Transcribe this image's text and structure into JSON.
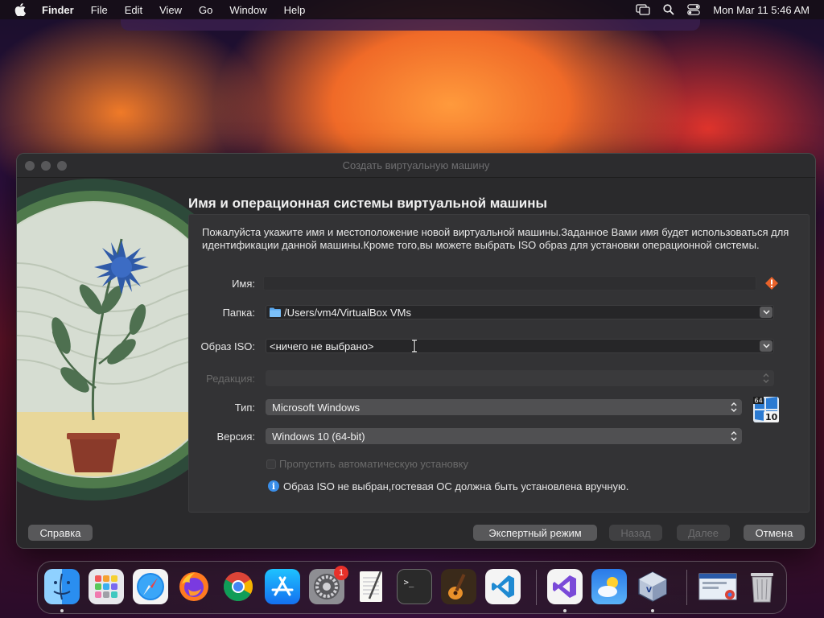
{
  "menubar": {
    "app_name": "Finder",
    "items": [
      "File",
      "Edit",
      "View",
      "Go",
      "Window",
      "Help"
    ],
    "clock": "Mon Mar 11  5:46 AM"
  },
  "window": {
    "title": "Создать виртуальную машину",
    "heading": "Имя и операционная системы виртуальной машины",
    "description": "Пожалуйста укажите имя и местоположение новой виртуальной машины.Заданное Вами имя будет использоваться для идентификации данной машины.Кроме того,вы можете выбрать ISO образ для установки операционной системы.",
    "form": {
      "name_label": "Имя:",
      "name_value": "",
      "folder_label": "Папка:",
      "folder_value": "/Users/vm4/VirtualBox VMs",
      "iso_label": "Образ ISO:",
      "iso_value": "<ничего не выбрано>",
      "edition_label": "Редакция:",
      "edition_value": "",
      "type_label": "Тип:",
      "type_value": "Microsoft Windows",
      "version_label": "Версия:",
      "version_value": "Windows 10 (64-bit)",
      "os_badge_top": "64",
      "os_badge_bottom": "10",
      "skip_unattended_label": "Пропустить автоматическую установку",
      "skip_unattended_checked": false,
      "info_text": "Образ ISO не выбран,гостевая ОС должна быть установлена вручную."
    },
    "buttons": {
      "help": "Справка",
      "expert": "Экспертный режим",
      "back": "Назад",
      "next": "Далее",
      "cancel": "Отмена"
    }
  },
  "dock": {
    "items": [
      {
        "name": "finder",
        "running": true
      },
      {
        "name": "launchpad",
        "running": false
      },
      {
        "name": "safari",
        "running": false
      },
      {
        "name": "firefox",
        "running": false
      },
      {
        "name": "chrome",
        "running": false
      },
      {
        "name": "app-store",
        "running": false
      },
      {
        "name": "system-settings",
        "running": false,
        "badge": "1"
      },
      {
        "name": "textedit",
        "running": false
      },
      {
        "name": "terminal",
        "running": false
      },
      {
        "name": "garageband",
        "running": false
      },
      {
        "name": "vscode",
        "running": false
      },
      {
        "name": "visual-studio",
        "running": true
      },
      {
        "name": "weather",
        "running": false
      },
      {
        "name": "virtualbox",
        "running": true
      },
      {
        "name": "chrome-window",
        "running": false
      },
      {
        "name": "trash",
        "running": false
      }
    ]
  },
  "colors": {
    "window_bg": "#2a2a2c",
    "accent_blue": "#3a8ee8",
    "warning_orange": "#e8622a"
  }
}
